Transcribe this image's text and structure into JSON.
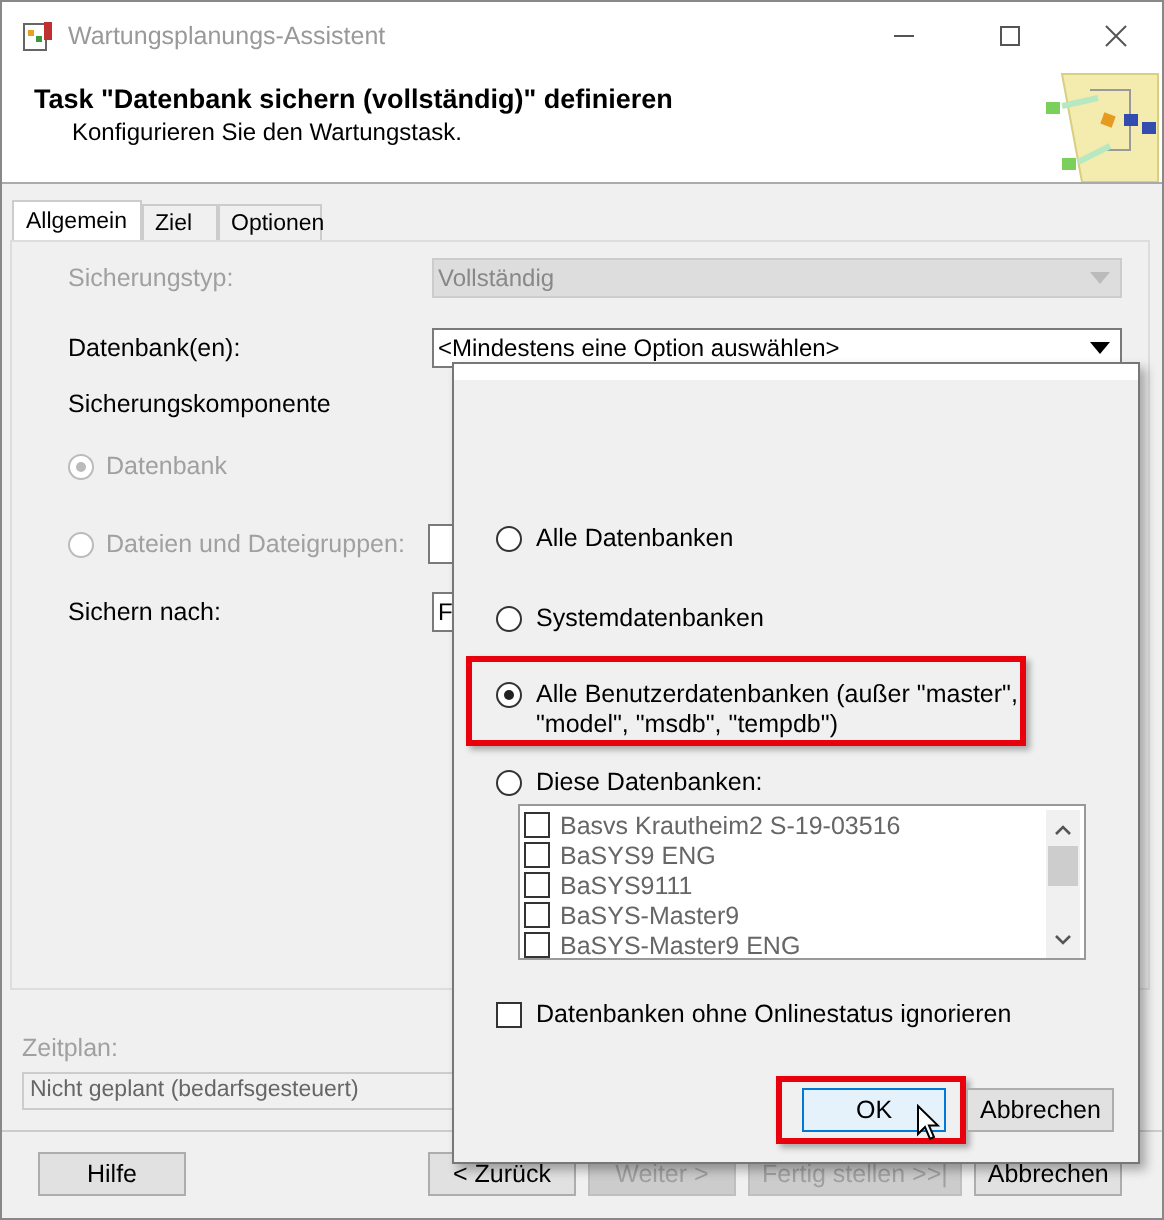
{
  "window": {
    "title": "Wartungsplanungs-Assistent"
  },
  "header": {
    "title": "Task \"Datenbank sichern (vollständig)\" definieren",
    "subtitle": "Konfigurieren Sie den Wartungstask."
  },
  "tabs": [
    {
      "label": "Allgemein",
      "selected": true
    },
    {
      "label": "Ziel",
      "selected": false
    },
    {
      "label": "Optionen",
      "selected": false
    }
  ],
  "form": {
    "rows": [
      {
        "kind": "select",
        "label": "Sicherungstyp:",
        "value": "Vollständig",
        "disabled": true
      },
      {
        "kind": "select",
        "label": "Datenbank(en):",
        "value": "<Mindestens eine Option auswählen>",
        "disabled": false
      },
      {
        "kind": "heading",
        "label": "Sicherungskomponente"
      },
      {
        "kind": "radio",
        "label": "Datenbank",
        "selected": true,
        "disabled": true
      },
      {
        "kind": "radio_field",
        "label": "Dateien und Dateigruppen:",
        "selected": false,
        "disabled": true
      },
      {
        "kind": "covered_select",
        "label": "Sichern nach:",
        "value": "F",
        "disabled": false
      }
    ]
  },
  "schedule": {
    "label": "Zeitplan:",
    "value": "Nicht geplant (bedarfsgesteuert)"
  },
  "buttons": [
    {
      "label": "Hilfe",
      "disabled": false
    },
    {
      "label": "< Zurück",
      "disabled": false
    },
    {
      "label": "Weiter >",
      "disabled": true
    },
    {
      "label": "Fertig stellen >>|",
      "disabled": true
    },
    {
      "label": "Abbrechen",
      "disabled": false
    }
  ],
  "popup": {
    "options": [
      {
        "label": "Alle Datenbanken",
        "selected": false,
        "highlighted": false
      },
      {
        "label": "Systemdatenbanken",
        "selected": false,
        "highlighted": false
      },
      {
        "label": "Alle Benutzerdatenbanken (außer \"master\", \"model\", \"msdb\", \"tempdb\")",
        "selected": true,
        "highlighted": true
      },
      {
        "label": "Diese Datenbanken:",
        "selected": false,
        "highlighted": false
      }
    ],
    "databases": [
      {
        "name": "Basvs  Krautheim2  S-19-03516",
        "checked": false
      },
      {
        "name": "BaSYS9  ENG",
        "checked": false
      },
      {
        "name": "BaSYS9111",
        "checked": false
      },
      {
        "name": "BaSYS-Master9",
        "checked": false
      },
      {
        "name": "BaSYS-Master9  ENG",
        "checked": false
      }
    ],
    "ignore_offline": {
      "label": "Datenbanken ohne Onlinestatus ignorieren",
      "checked": false
    },
    "buttons": [
      {
        "label": "OK",
        "highlighted": true
      },
      {
        "label": "Abbrechen",
        "highlighted": false
      }
    ]
  }
}
